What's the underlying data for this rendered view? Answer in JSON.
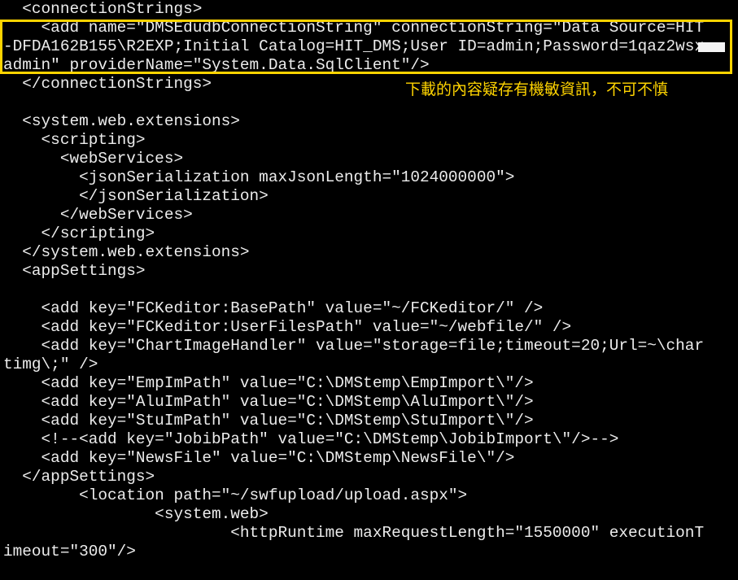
{
  "code_lines": [
    "  <connectionStrings>",
    "    <add name=\"DMSEdudbConnectionString\" connectionString=\"Data Source=HIT",
    "-DFDA162B155\\R2EXP;Initial Catalog=HIT_DMS;User ID=admin;Password=1qaz2wsx",
    "admin\" providerName=\"System.Data.SqlClient\"/>",
    "  </connectionStrings>",
    "",
    "  <system.web.extensions>",
    "    <scripting>",
    "      <webServices>",
    "        <jsonSerialization maxJsonLength=\"1024000000\">",
    "        </jsonSerialization>",
    "      </webServices>",
    "    </scripting>",
    "  </system.web.extensions>",
    "  <appSettings>",
    "",
    "    <add key=\"FCKeditor:BasePath\" value=\"~/FCKeditor/\" />",
    "    <add key=\"FCKeditor:UserFilesPath\" value=\"~/webfile/\" />",
    "    <add key=\"ChartImageHandler\" value=\"storage=file;timeout=20;Url=~\\char",
    "timg\\;\" />",
    "    <add key=\"EmpImPath\" value=\"C:\\DMStemp\\EmpImport\\\"/>",
    "    <add key=\"AluImPath\" value=\"C:\\DMStemp\\AluImport\\\"/>",
    "    <add key=\"StuImPath\" value=\"C:\\DMStemp\\StuImport\\\"/>",
    "    <!--<add key=\"JobibPath\" value=\"C:\\DMStemp\\JobibImport\\\"/>-->",
    "    <add key=\"NewsFile\" value=\"C:\\DMStemp\\NewsFile\\\"/>",
    "  </appSettings>",
    "        <location path=\"~/swfupload/upload.aspx\">",
    "                <system.web>",
    "                        <httpRuntime maxRequestLength=\"1550000\" executionT",
    "imeout=\"300\"/>"
  ],
  "annotation": "下載的內容疑存有機敏資訊，不可不慎",
  "colors": {
    "background": "#000000",
    "code_text": "#ececec",
    "highlight": "#ffd400",
    "redaction": "#f4f4f4"
  }
}
